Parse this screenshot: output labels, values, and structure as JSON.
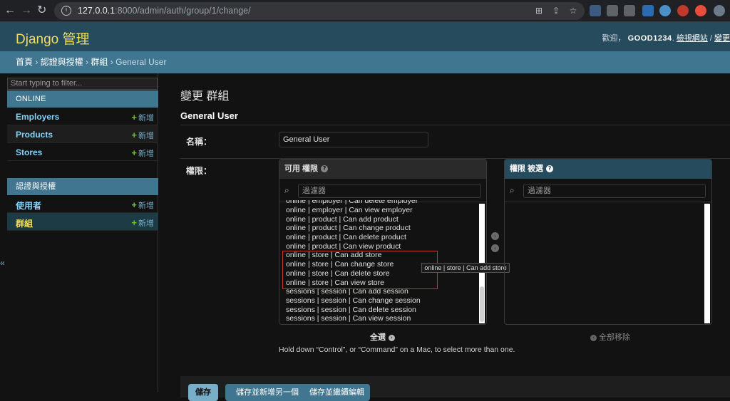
{
  "browser": {
    "url_host": "127.0.0.1",
    "url_path": ":8000/admin/auth/group/1/change/"
  },
  "header": {
    "brand": "Django 管理",
    "welcome": "歡迎，",
    "username": "GOOD1234",
    "view_site": "檢視網站",
    "separator": "/",
    "change_password": "變更"
  },
  "breadcrumbs": {
    "home": "首頁",
    "sep": "›",
    "app": "認證與授權",
    "model": "群組",
    "current": "General User"
  },
  "sidebar": {
    "filter_placeholder": "Start typing to filter...",
    "toggle": "«",
    "apps": [
      {
        "caption": "ONLINE",
        "models": [
          {
            "name": "Employers",
            "add": "新增"
          },
          {
            "name": "Products",
            "add": "新增"
          },
          {
            "name": "Stores",
            "add": "新增"
          }
        ]
      },
      {
        "caption": "認證與授權",
        "models": [
          {
            "name": "使用者",
            "add": "新增"
          },
          {
            "name": "群組",
            "add": "新增"
          }
        ]
      }
    ]
  },
  "main": {
    "page_title": "變更 群組",
    "object_name": "General User",
    "name_label": "名稱：",
    "name_value": "General User",
    "permissions_label": "權限：",
    "available_title": "可用 權限",
    "chosen_title": "權限 被選",
    "filter_placeholder": "過濾器",
    "available_options": [
      "online | employer | Can delete employer",
      "online | employer | Can view employer",
      "online | product | Can add product",
      "online | product | Can change product",
      "online | product | Can delete product",
      "online | product | Can view product",
      "online | store | Can add store",
      "online | store | Can change store",
      "online | store | Can delete store",
      "online | store | Can view store",
      "sessions | session | Can add session",
      "sessions | session | Can change session",
      "sessions | session | Can delete session",
      "sessions | session | Can view session"
    ],
    "tooltip": "online | store | Can add store",
    "choose_all": "全選",
    "remove_all": "全部移除",
    "help_text": "Hold down “Control”, or “Command” on a Mac, to select more than one."
  },
  "submit": {
    "save": "儲存",
    "save_add": "儲存並新增另一個",
    "save_continue": "儲存並繼續編輯"
  }
}
